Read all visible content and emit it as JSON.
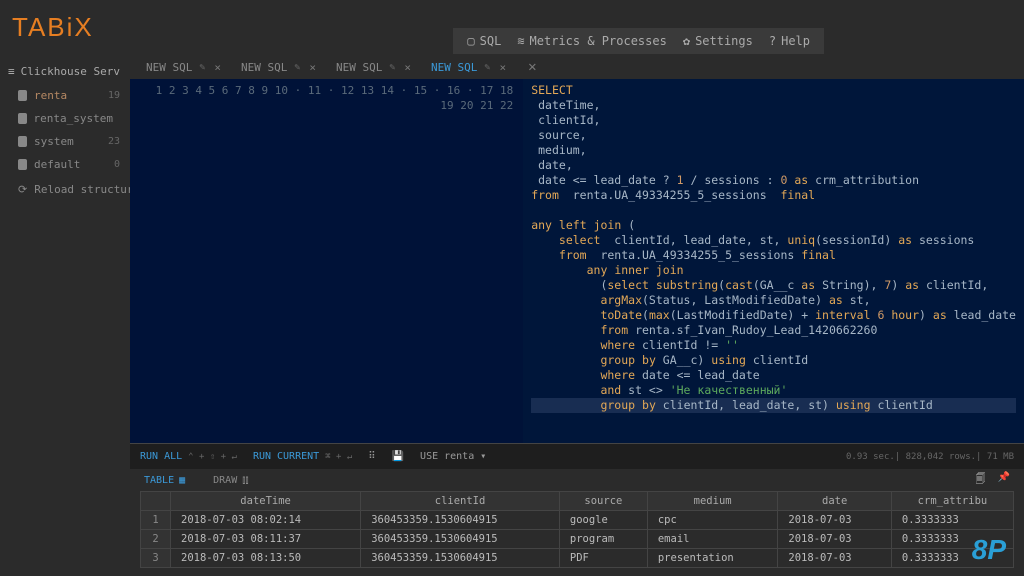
{
  "brand": "TABiX",
  "topmenu": {
    "sql": "SQL",
    "metrics": "Metrics & Processes",
    "settings": "Settings",
    "help": "Help"
  },
  "sidebar": {
    "server_label": "Clickhouse Serv",
    "items": [
      {
        "name": "renta",
        "count": "19",
        "active": true
      },
      {
        "name": "renta_system",
        "count": ""
      },
      {
        "name": "system",
        "count": "23"
      },
      {
        "name": "default",
        "count": "0"
      }
    ],
    "reload": "Reload structur"
  },
  "tabs": {
    "list": [
      {
        "label": "NEW SQL",
        "active": false
      },
      {
        "label": "NEW SQL",
        "active": false
      },
      {
        "label": "NEW SQL",
        "active": false
      },
      {
        "label": "NEW SQL",
        "active": true
      }
    ]
  },
  "editor": {
    "lines": [
      "SELECT",
      " dateTime,",
      " clientId,",
      " source,",
      " medium,",
      " date,",
      " date <= lead_date ? 1 / sessions : 0 as crm_attribution",
      "from  renta.UA_49334255_5_sessions  final",
      "",
      "any left join (",
      "    select  clientId, lead_date, st, uniq(sessionId) as sessions",
      "    from  renta.UA_49334255_5_sessions final",
      "        any inner join",
      "          (select substring(cast(GA__c as String), 7) as clientId,",
      "          argMax(Status, LastModifiedDate) as st,",
      "          toDate(max(LastModifiedDate) + interval 6 hour) as lead_date",
      "          from renta.sf_Ivan_Rudoy_Lead_1420662260",
      "          where clientId != ''",
      "          group by GA__c) using clientId",
      "          where date <= lead_date",
      "          and st <> 'Не качественный'",
      "          group by clientId, lead_date, st) using clientId"
    ]
  },
  "toolbar": {
    "run_all": "RUN ALL",
    "run_all_keys": "⌃ + ⇧ + ↵",
    "run_current": "RUN CURRENT",
    "run_current_keys": "⌘ + ↵",
    "use": "USE",
    "db": "renta",
    "stats": "0.93 sec.| 828,042 rows.| 71 MB"
  },
  "viewtabs": {
    "table": "TABLE",
    "draw": "DRAW"
  },
  "grid": {
    "headers": [
      "dateTime",
      "clientId",
      "source",
      "medium",
      "date",
      "crm_attribu"
    ],
    "rows": [
      [
        "2018-07-03 08:02:14",
        "360453359.1530604915",
        "google",
        "cpc",
        "2018-07-03",
        "0.3333333"
      ],
      [
        "2018-07-03 08:11:37",
        "360453359.1530604915",
        "program",
        "email",
        "2018-07-03",
        "0.3333333"
      ],
      [
        "2018-07-03 08:13:50",
        "360453359.1530604915",
        "PDF",
        "presentation",
        "2018-07-03",
        "0.3333333"
      ]
    ]
  },
  "watermark": "8P"
}
